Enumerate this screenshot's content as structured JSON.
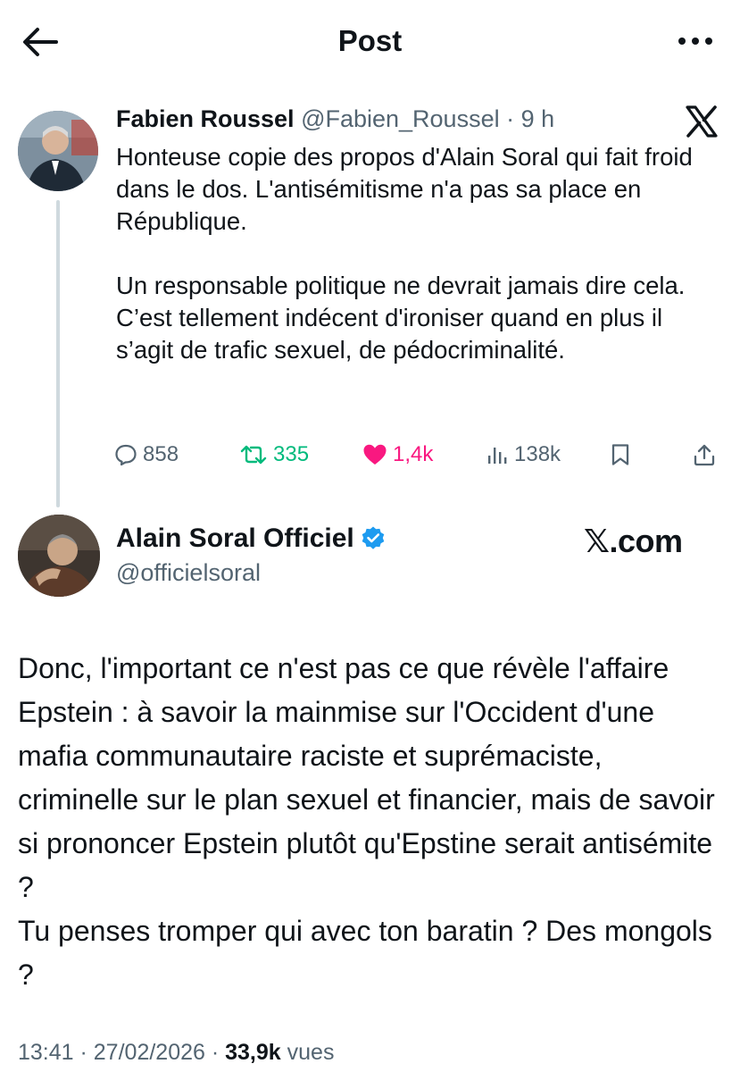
{
  "header": {
    "title": "Post",
    "back_icon": "arrow-left-icon",
    "more_icon": "more-horizontal-icon"
  },
  "quoted_tweet": {
    "name": "Fabien Roussel",
    "handle": "@Fabien_Roussel",
    "separator": " · ",
    "time": "9 h",
    "body": [
      "Honteuse copie des propos d'Alain Soral qui fait froid dans le dos. L'antisémitisme n'a pas sa place en République.",
      "Un responsable politique ne devrait jamais dire cela. C’est tellement indécent d'ironiser quand en plus il s’agit de trafic sexuel, de pédocriminalité."
    ],
    "stats": {
      "replies": "858",
      "retweets": "335",
      "likes": "1,4k",
      "views": "138k"
    }
  },
  "main_tweet": {
    "name": "Alain Soral Officiel",
    "handle": "@officielsoral",
    "watermark": "𝕏.com",
    "body": [
      "Donc, l'important ce n'est pas ce que révèle l'affaire Epstein : à savoir la mainmise sur l'Occident d'une mafia communautaire raciste et suprémaciste, criminelle sur le plan sexuel et financier, mais de savoir si prononcer Epstein plutôt qu'Epstine serait antisémite ?",
      "Tu penses tromper qui avec ton baratin ? Des mongols ?"
    ],
    "time": "13:41",
    "date": "27/02/2026",
    "views": "33,9k",
    "views_label": "vues"
  },
  "colors": {
    "text": "#0f1419",
    "muted": "#536471",
    "retweet": "#00ba7c",
    "like": "#f91880",
    "verified": "#1d9bf0",
    "thread": "#cfd9de"
  }
}
